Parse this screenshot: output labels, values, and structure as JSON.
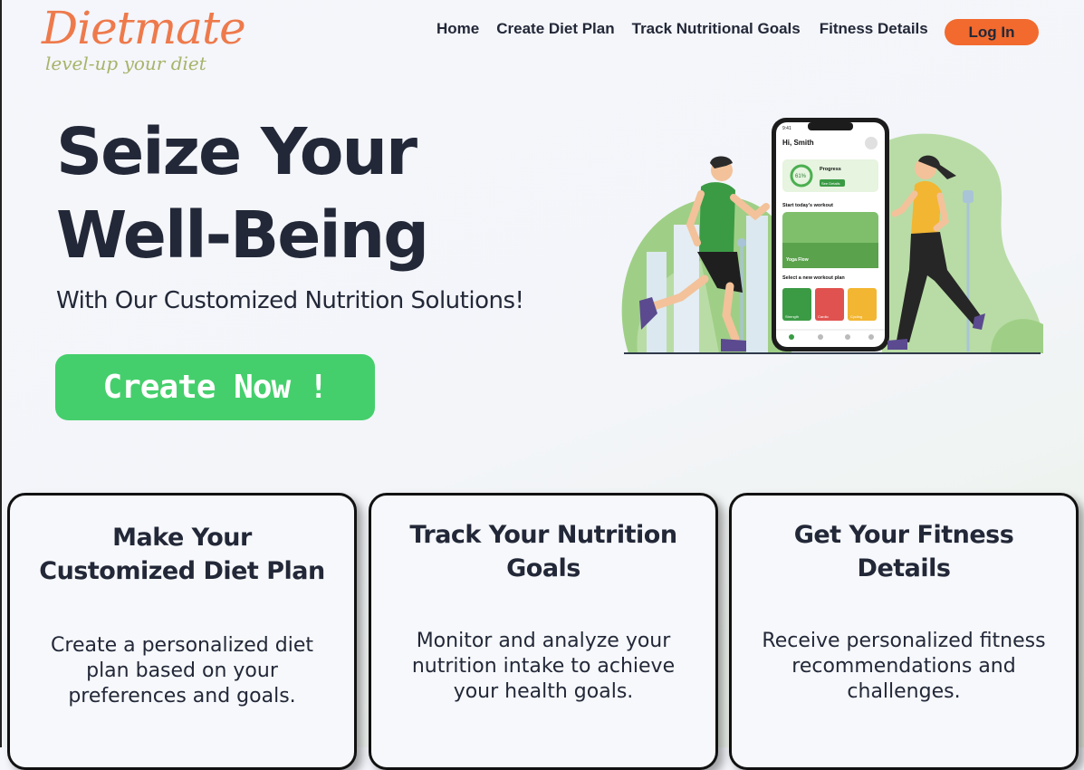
{
  "brand": {
    "name": "Dietmate",
    "tagline": "level-up your diet",
    "accent": "#ee7a4c"
  },
  "nav": {
    "items": [
      "Home",
      "Create Diet Plan",
      "Track Nutritional Goals",
      "Fitness Details"
    ],
    "login_label": "Log In",
    "login_color": "#f26a2e"
  },
  "hero": {
    "title_line1": "Seize Your",
    "title_line2": "Well-Being",
    "subtitle": "With Our Customized Nutrition Solutions!",
    "cta_label": "Create Now !",
    "cta_color": "#45cf6c"
  },
  "phone": {
    "time": "9:41",
    "greeting": "Hi, Smith",
    "progress_value": "61%",
    "progress_label": "Progress",
    "progress_button": "See Details",
    "workout_heading": "Start today's workout",
    "workout_name": "Yoga Flow",
    "plan_heading": "Select a new workout plan",
    "plans": [
      "Strength",
      "Cardio",
      "Cycling"
    ]
  },
  "cards": [
    {
      "title_line1": "Make Your",
      "title_line2": "Customized Diet Plan",
      "desc": [
        "Create a personalized diet",
        "plan based on your",
        "preferences and goals."
      ]
    },
    {
      "title_line1": "Track Your Nutrition",
      "title_line2": "Goals",
      "desc": [
        "Monitor and analyze your",
        "nutrition intake to achieve",
        "your health goals."
      ]
    },
    {
      "title_line1": "Get Your Fitness",
      "title_line2": "Details",
      "desc": [
        "Receive personalized fitness",
        "recommendations and",
        "challenges."
      ]
    }
  ]
}
